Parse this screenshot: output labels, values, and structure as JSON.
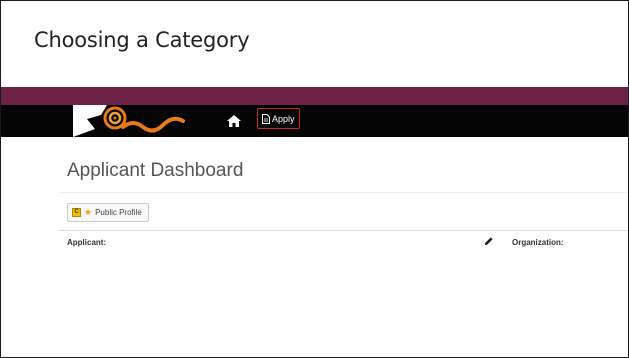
{
  "slide": {
    "title": "Choosing a Category"
  },
  "colors": {
    "accent_band": "#6e2147",
    "navbar": "#050505",
    "apply_border": "#c62828",
    "logo_orange": "#e87a1a"
  },
  "navbar": {
    "logo_icon": "swirl-logo-icon",
    "home_icon": "home-icon",
    "apply_label": "Apply",
    "apply_icon": "document-icon"
  },
  "dashboard": {
    "title": "Applicant Dashboard",
    "profile_button": {
      "badge": "C",
      "star_icon": "star-icon",
      "label": "Public Profile"
    },
    "applicant_label": "Applicant:",
    "edit_icon": "pencil-icon",
    "organization_label": "Organization:"
  }
}
